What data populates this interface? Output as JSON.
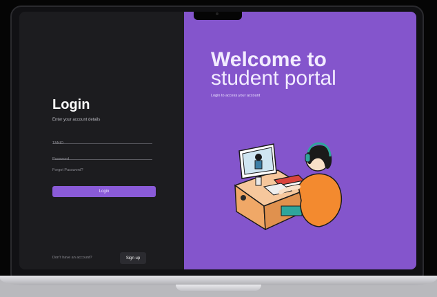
{
  "login": {
    "title": "Login",
    "subtitle": "Enter your account details",
    "tanid_placeholder": "TANID",
    "password_placeholder": "Password",
    "forgot": "Forgot Password?",
    "login_button": "Login",
    "no_account": "Don't have an account?",
    "signup_button": "Sign up"
  },
  "hero": {
    "welcome_line1": "Welcome to",
    "welcome_line2": "student portal",
    "subtitle": "Login to access your account"
  },
  "colors": {
    "left_panel": "#1c1c1f",
    "right_panel": "#8455cc",
    "accent_button": "#8a5bd8"
  },
  "icons": {
    "illustration": "student-at-computer-illustration"
  }
}
